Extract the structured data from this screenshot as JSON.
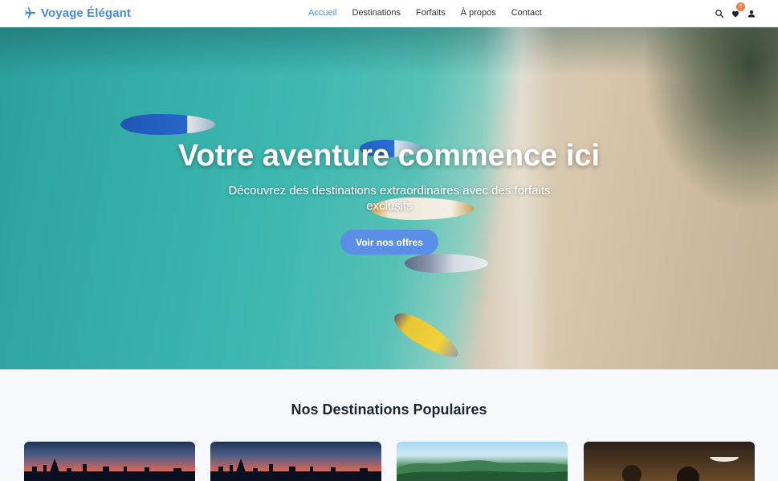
{
  "header": {
    "brand": "Voyage Élégant",
    "nav": [
      {
        "label": "Accueil",
        "active": true
      },
      {
        "label": "Destinations",
        "active": false
      },
      {
        "label": "Forfaits",
        "active": false
      },
      {
        "label": "À propos",
        "active": false
      },
      {
        "label": "Contact",
        "active": false
      }
    ],
    "icons": [
      "search-icon",
      "heart-icon",
      "user-icon"
    ],
    "favorites_count": "3"
  },
  "hero": {
    "title": "Votre aventure commence ici",
    "subtitle": "Découvrez des destinations extraordinaires avec des forfaits exclusifs",
    "cta": "Voir nos offres"
  },
  "destinations": {
    "title": "Nos Destinations Populaires"
  },
  "colors": {
    "accent": "#4a89dc",
    "cta": "#5b8fe6",
    "badge": "#ef7d4a"
  }
}
